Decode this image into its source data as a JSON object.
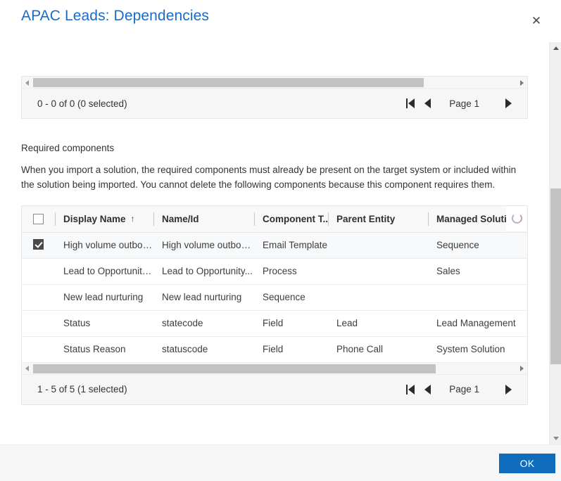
{
  "dialog": {
    "title": "APAC Leads: Dependencies",
    "close_label": "✕"
  },
  "top_grid": {
    "count_text": "0 - 0 of 0 (0 selected)",
    "page_label": "Page 1",
    "first_page_title": "First page",
    "prev_page_title": "Previous page",
    "next_page_title": "Next page",
    "hscroll_left_title": "Scroll left",
    "hscroll_right_title": "Scroll right"
  },
  "section": {
    "title": "Required components",
    "description": "When you import a solution, the required components must already be present on the target system or included within the solution being imported. You cannot delete the following components because this component requires them."
  },
  "table": {
    "select_all_checked": false,
    "sort_indicator": "↑",
    "columns": [
      {
        "key": "check",
        "label": ""
      },
      {
        "key": "display",
        "label": "Display Name"
      },
      {
        "key": "name",
        "label": "Name/Id"
      },
      {
        "key": "type",
        "label": "Component T.."
      },
      {
        "key": "parent",
        "label": "Parent Entity"
      },
      {
        "key": "managed",
        "label": "Managed Solution"
      }
    ],
    "rows": [
      {
        "selected": true,
        "display": "High volume outbou...",
        "name": "High volume outbou...",
        "type": "Email Template",
        "parent": "",
        "managed": "Sequence"
      },
      {
        "selected": false,
        "display": "Lead to Opportunity...",
        "name": "Lead to Opportunity...",
        "type": "Process",
        "parent": "",
        "managed": "Sales"
      },
      {
        "selected": false,
        "display": "New lead nurturing",
        "name": "New lead nurturing",
        "type": "Sequence",
        "parent": "",
        "managed": ""
      },
      {
        "selected": false,
        "display": "Status",
        "name": "statecode",
        "type": "Field",
        "parent": "Lead",
        "managed": "Lead Management"
      },
      {
        "selected": false,
        "display": "Status Reason",
        "name": "statuscode",
        "type": "Field",
        "parent": "Phone Call",
        "managed": "System Solution"
      }
    ]
  },
  "bottom_grid": {
    "count_text": "1 - 5 of 5 (1 selected)",
    "page_label": "Page 1"
  },
  "footer": {
    "ok_label": "OK"
  },
  "colors": {
    "title": "#1a6bc4",
    "primary_button": "#0f6cbd",
    "header_bg": "#f8f8f8",
    "pager_bg": "#f6f6f6",
    "scroll_thumb": "#c2c2c2"
  }
}
